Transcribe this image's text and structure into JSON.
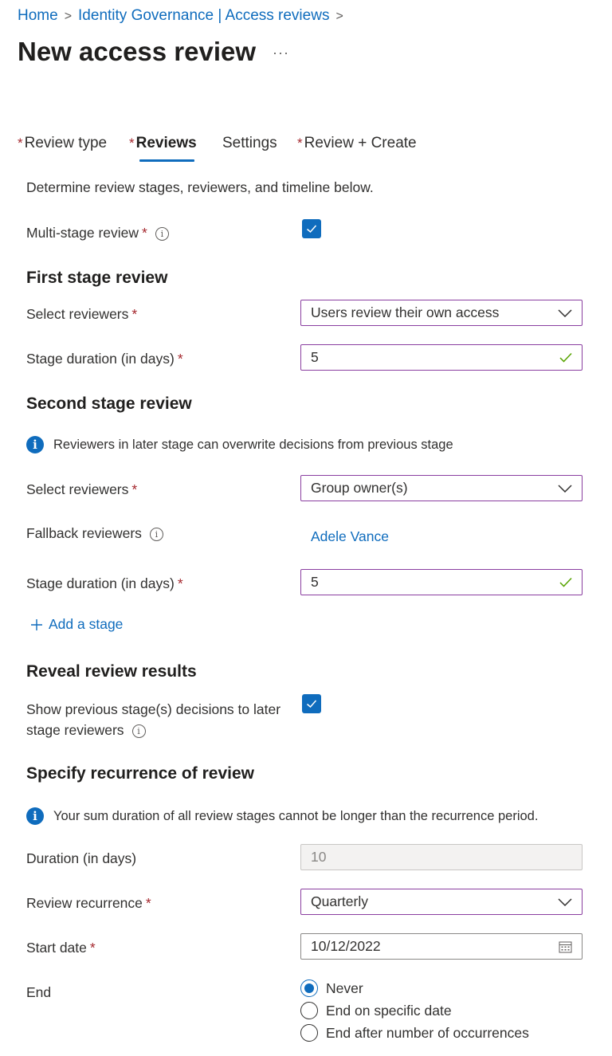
{
  "breadcrumb": {
    "items": [
      "Home",
      "Identity Governance | Access reviews"
    ],
    "separator": ">"
  },
  "page": {
    "title": "New access review",
    "more_label": "···"
  },
  "tabs": [
    {
      "label": "Review type",
      "required": true
    },
    {
      "label": "Reviews",
      "required": true,
      "active": true
    },
    {
      "label": "Settings",
      "required": false
    },
    {
      "label": "Review + Create",
      "required": true
    }
  ],
  "required_marker": "*",
  "intro": "Determine review stages, reviewers, and timeline below.",
  "multi_stage": {
    "label": "Multi-stage review",
    "checked": true
  },
  "first_stage": {
    "heading": "First stage review",
    "reviewers_label": "Select reviewers",
    "reviewers_value": "Users review their own access",
    "duration_label": "Stage duration (in days)",
    "duration_value": "5"
  },
  "second_stage": {
    "heading": "Second stage review",
    "info": "Reviewers in later stage can overwrite decisions from previous stage",
    "reviewers_label": "Select reviewers",
    "reviewers_value": "Group owner(s)",
    "fallback_label": "Fallback reviewers",
    "fallback_value": "Adele Vance",
    "duration_label": "Stage duration (in days)",
    "duration_value": "5"
  },
  "add_stage": {
    "label": "Add a stage",
    "icon": "plus-icon"
  },
  "reveal": {
    "heading": "Reveal review results",
    "label_line1": "Show previous stage(s) decisions to later",
    "label_line2": "stage reviewers",
    "checked": true
  },
  "recurrence": {
    "heading": "Specify recurrence of review",
    "info": "Your sum duration of all review stages cannot be longer than the recurrence period.",
    "duration_label": "Duration (in days)",
    "duration_value": "10",
    "recurrence_label": "Review recurrence",
    "recurrence_value": "Quarterly",
    "start_label": "Start date",
    "start_value": "10/12/2022",
    "end_label": "End",
    "end_options": [
      {
        "label": "Never",
        "selected": true
      },
      {
        "label": "End on specific date",
        "selected": false
      },
      {
        "label": "End after number of occurrences",
        "selected": false
      }
    ]
  },
  "colors": {
    "accent": "#0f6cbd",
    "required": "#a4262c",
    "valid": "#57a300",
    "field_border": "#8a3ea0"
  }
}
